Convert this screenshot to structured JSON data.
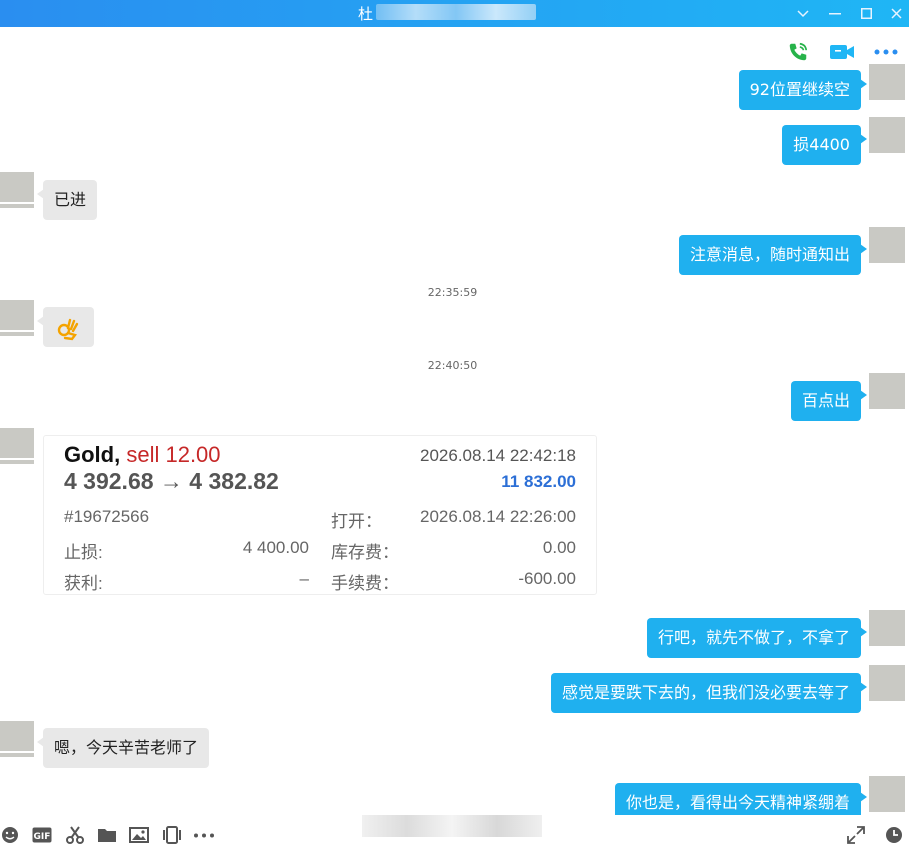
{
  "window": {
    "title": "杜"
  },
  "messages": {
    "m1": "92位置继续空",
    "m2": "损4400",
    "m3": "已进",
    "m4": "注意消息，随时通知出",
    "ts1": "22:35:59",
    "m5_icon": "ok-hand-emoji",
    "ts2": "22:40:50",
    "m6": "百点出",
    "m7": "行吧，就先不做了，不拿了",
    "m8": "感觉是要跌下去的，但我们没必要去等了",
    "m9": "嗯，今天辛苦老师了",
    "m10": "你也是，看得出今天精神紧绷着"
  },
  "trade": {
    "symbol": "Gold,",
    "side": "sell 12.00",
    "price_move": "4 392.68 → 4 382.82",
    "close_time": "2026.08.14 22:42:18",
    "profit": "11 832.00",
    "order_id": "#19672566",
    "open_label": "打开：",
    "open_time": "2026.08.14 22:26:00",
    "sl_label": "止损:",
    "sl_value": "4 400.00",
    "swap_label": "库存费：",
    "swap_value": "0.00",
    "tp_label": "获利:",
    "tp_value": "–",
    "fee_label": "手续费：",
    "fee_value": "-600.00"
  },
  "colors": {
    "outgoing": "#1fb0ef",
    "incoming": "#e8e8e8",
    "titlebar": "#1fb6f5",
    "sell": "#c62828",
    "profit": "#2c6fd6"
  }
}
